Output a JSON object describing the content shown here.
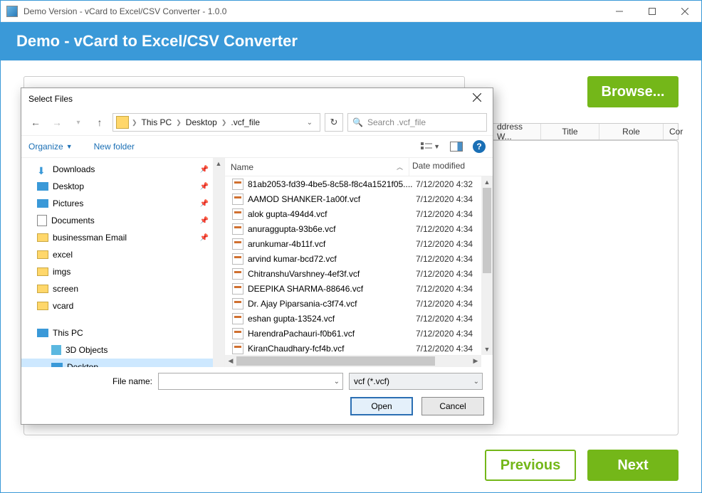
{
  "window": {
    "title": "Demo Version - vCard to Excel/CSV Converter - 1.0.0"
  },
  "banner": {
    "title": "Demo - vCard to Excel/CSV Converter"
  },
  "main": {
    "browse": "Browse...",
    "previous": "Previous",
    "next": "Next",
    "columns": {
      "addressW": "ddress W...",
      "title": "Title",
      "role": "Role",
      "cor": "Cor"
    }
  },
  "dialog": {
    "title": "Select Files",
    "breadcrumb": {
      "root": "This PC",
      "seg1": "Desktop",
      "seg2": ".vcf_file"
    },
    "searchPlaceholder": "Search .vcf_file",
    "organize": "Organize",
    "newFolder": "New folder",
    "headers": {
      "name": "Name",
      "date": "Date modified"
    },
    "tree": [
      {
        "icon": "dl",
        "label": "Downloads",
        "pin": true
      },
      {
        "icon": "desk",
        "label": "Desktop",
        "pin": true
      },
      {
        "icon": "pic",
        "label": "Pictures",
        "pin": true
      },
      {
        "icon": "doc",
        "label": "Documents",
        "pin": true
      },
      {
        "icon": "fold",
        "label": "businessman Email",
        "pin": true
      },
      {
        "icon": "fold",
        "label": "excel"
      },
      {
        "icon": "fold",
        "label": "imgs"
      },
      {
        "icon": "fold",
        "label": "screen"
      },
      {
        "icon": "fold",
        "label": "vcard"
      },
      {
        "spacer": true
      },
      {
        "icon": "pc",
        "label": "This PC",
        "chev": true
      },
      {
        "icon": "3d",
        "label": "3D Objects",
        "indent": true
      },
      {
        "icon": "desk",
        "label": "Desktop",
        "indent": true,
        "sel": true,
        "chev": true
      }
    ],
    "files": [
      {
        "name": "81ab2053-fd39-4be5-8c58-f8c4a1521f05....",
        "date": "7/12/2020 4:32"
      },
      {
        "name": "AAMOD SHANKER-1a00f.vcf",
        "date": "7/12/2020 4:34"
      },
      {
        "name": "alok gupta-494d4.vcf",
        "date": "7/12/2020 4:34"
      },
      {
        "name": "anuraggupta-93b6e.vcf",
        "date": "7/12/2020 4:34"
      },
      {
        "name": "arunkumar-4b11f.vcf",
        "date": "7/12/2020 4:34"
      },
      {
        "name": "arvind kumar-bcd72.vcf",
        "date": "7/12/2020 4:34"
      },
      {
        "name": "ChitranshuVarshney-4ef3f.vcf",
        "date": "7/12/2020 4:34"
      },
      {
        "name": "DEEPIKA SHARMA-88646.vcf",
        "date": "7/12/2020 4:34"
      },
      {
        "name": "Dr. Ajay Piparsania-c3f74.vcf",
        "date": "7/12/2020 4:34"
      },
      {
        "name": "eshan gupta-13524.vcf",
        "date": "7/12/2020 4:34"
      },
      {
        "name": "HarendraPachauri-f0b61.vcf",
        "date": "7/12/2020 4:34"
      },
      {
        "name": "KiranChaudhary-fcf4b.vcf",
        "date": "7/12/2020 4:34"
      }
    ],
    "fileNameLabel": "File name:",
    "fileNameValue": "",
    "filterValue": "vcf (*.vcf)",
    "open": "Open",
    "cancel": "Cancel"
  }
}
